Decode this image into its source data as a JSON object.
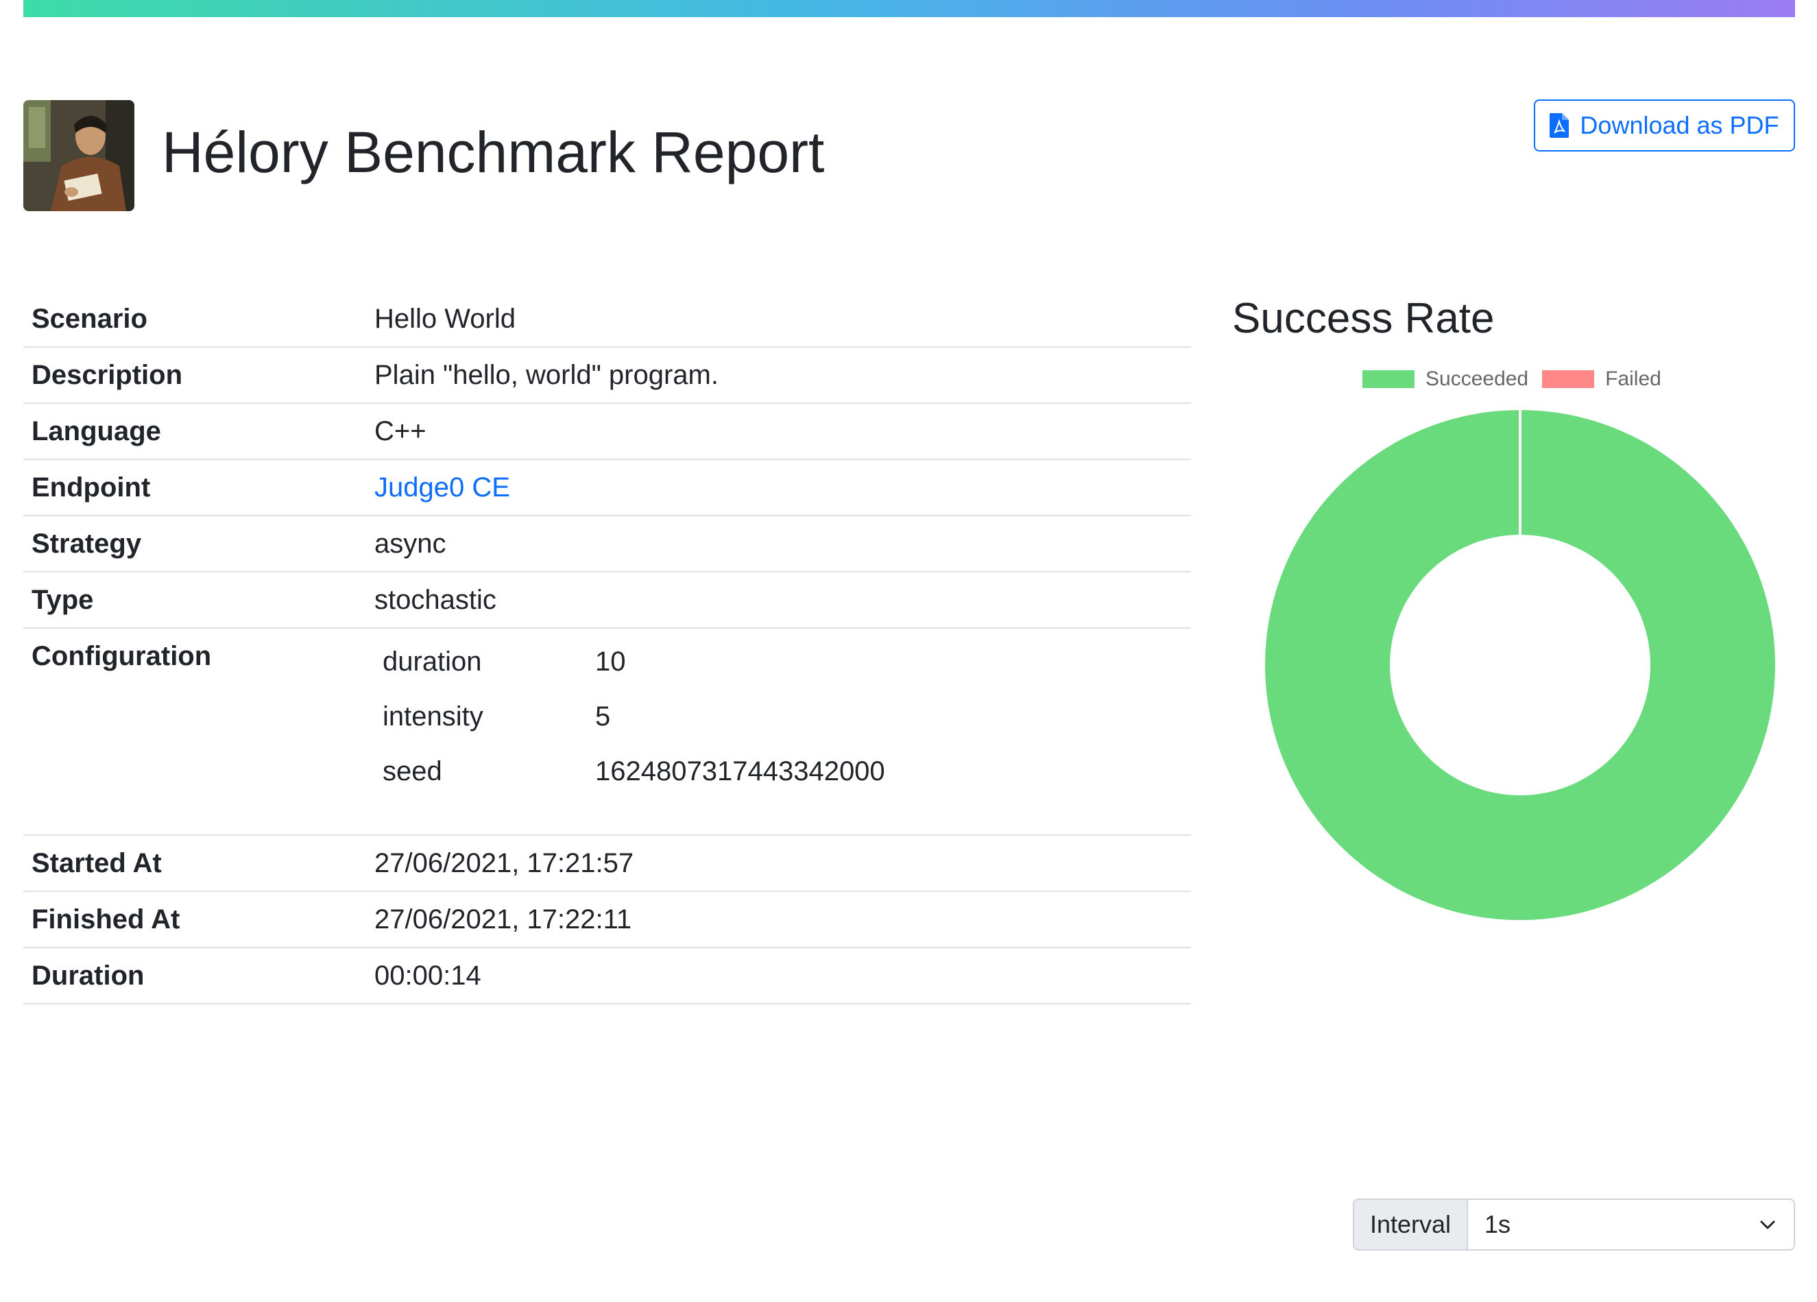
{
  "header": {
    "title": "Hélory Benchmark Report",
    "pdf_button_label": "Download as PDF"
  },
  "details": {
    "scenario_label": "Scenario",
    "scenario": "Hello World",
    "description_label": "Description",
    "description": "Plain \"hello, world\" program.",
    "language_label": "Language",
    "language": "C++",
    "endpoint_label": "Endpoint",
    "endpoint": "Judge0 CE",
    "strategy_label": "Strategy",
    "strategy": "async",
    "type_label": "Type",
    "type": "stochastic",
    "configuration_label": "Configuration",
    "configuration": [
      {
        "key": "duration",
        "value": "10"
      },
      {
        "key": "intensity",
        "value": "5"
      },
      {
        "key": "seed",
        "value": "1624807317443342000"
      }
    ],
    "started_label": "Started At",
    "started": "27/06/2021, 17:21:57",
    "finished_label": "Finished At",
    "finished": "27/06/2021, 17:22:11",
    "duration_label": "Duration",
    "duration": "00:00:14"
  },
  "chart_data": {
    "type": "pie",
    "title": "Success Rate",
    "categories": [
      "Succeeded",
      "Failed"
    ],
    "values": [
      1,
      0
    ],
    "colors": [
      "#69db7c",
      "#ff8787"
    ],
    "legend": "top"
  },
  "controls": {
    "interval_label": "Interval",
    "interval_value": "1s"
  },
  "colors": {
    "accent": "#0d6efd",
    "succeeded": "#69db7c",
    "failed": "#ff8787"
  }
}
